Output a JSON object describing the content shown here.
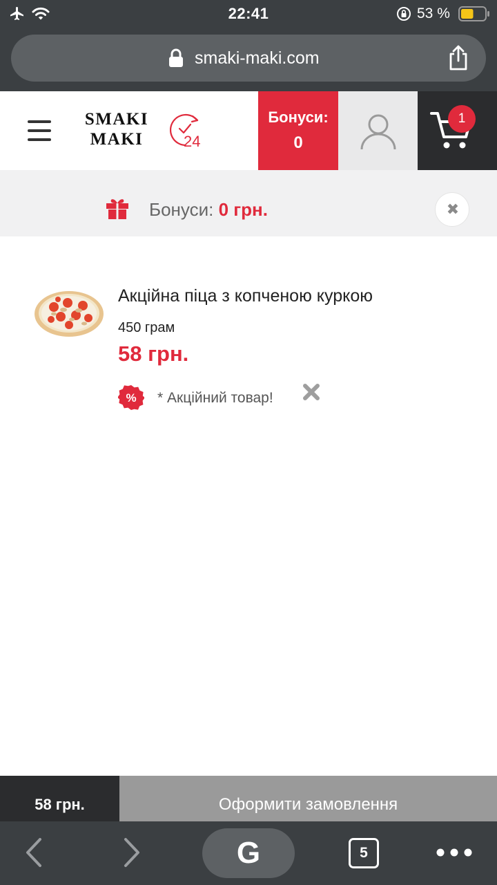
{
  "status_bar": {
    "time": "22:41",
    "battery_text": "53 %",
    "battery_level": 0.53,
    "battery_color": "#f5c518"
  },
  "browser": {
    "url": "smaki-maki.com",
    "tab_count": "5",
    "search_button_glyph": "G"
  },
  "header": {
    "logo_line1": "SMAKI",
    "logo_line2": "MAKI",
    "clock_number": "24",
    "bonus_label": "Бонуси:",
    "bonus_value": "0",
    "cart_count": "1"
  },
  "bonus_strip": {
    "label": "Бонуси:",
    "amount": "0",
    "currency": "грн."
  },
  "cart_item": {
    "title": "Акційна піца з копченою куркою",
    "weight": "450 грам",
    "price": "58 грн.",
    "promo_badge_glyph": "%",
    "promo_note": "* Акційний товар!"
  },
  "checkout": {
    "total": "58 грн.",
    "order_button": "Оформити замовлення"
  },
  "colors": {
    "accent_red": "#e02a3c",
    "dark": "#2b2c2e",
    "browser_chrome": "#3b3f42",
    "order_button_bg": "#9a9a9a"
  },
  "icons": {
    "status": [
      "airplane-icon",
      "wifi-icon",
      "orientation-lock-icon",
      "battery-icon"
    ],
    "browser": [
      "padlock-icon",
      "share-icon",
      "back-icon",
      "forward-icon",
      "tabs-icon",
      "more-icon"
    ],
    "site": [
      "hamburger-icon",
      "clock-24-icon",
      "user-icon",
      "cart-icon",
      "gift-icon",
      "close-icon",
      "percent-badge-icon",
      "remove-icon"
    ]
  }
}
